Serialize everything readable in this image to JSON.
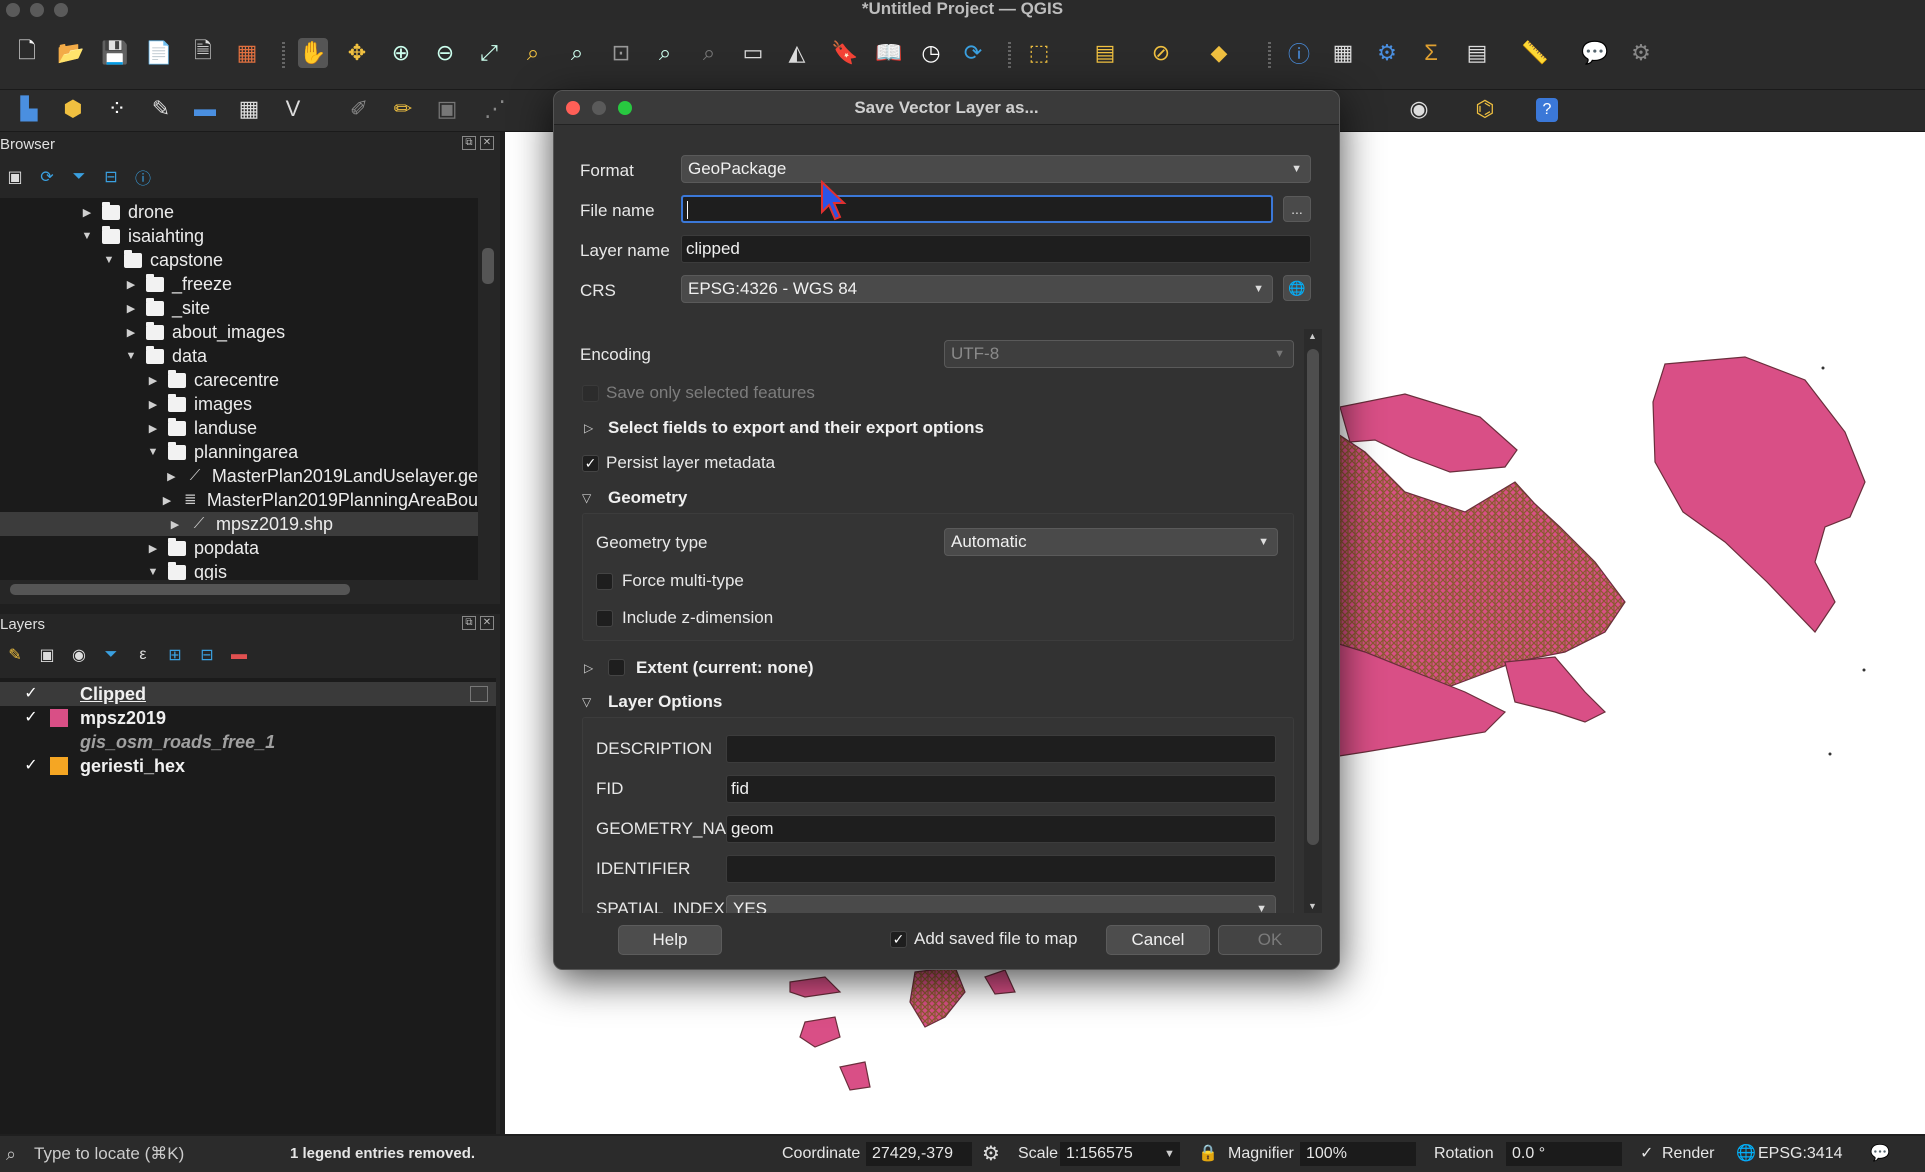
{
  "window": {
    "title": "*Untitled Project — QGIS"
  },
  "toolbar1": {
    "icons": [
      "new-project-icon",
      "open-project-icon",
      "save-project-icon",
      "new-print-layout-icon",
      "layout-manager-icon",
      "style-manager-icon",
      "pan-icon",
      "pan-to-selection-icon",
      "zoom-in-icon",
      "zoom-out-icon",
      "zoom-full-icon",
      "zoom-to-selection-icon",
      "zoom-to-layer-icon",
      "zoom-native-icon",
      "zoom-last-icon",
      "zoom-next-icon",
      "new-map-view-icon",
      "new-3d-view-icon",
      "new-bookmark-icon",
      "show-bookmarks-icon",
      "temporal-controller-icon",
      "refresh-icon",
      "select-features-icon",
      "select-by-value-icon",
      "deselect-icon",
      "select-location-icon",
      "identify-icon",
      "attribute-table-icon",
      "processing-toolbox-icon",
      "statistics-icon",
      "open-table-icon",
      "measure-icon",
      "map-tips-icon",
      "settings-gear-icon"
    ]
  },
  "toolbar2": {
    "icons": [
      "data-source-manager-icon",
      "new-geopackage-icon",
      "new-shapefile-icon",
      "digitize-icon",
      "add-layer-icon",
      "virtual-layer-icon",
      "new-vector-icon",
      "edit-pencil-icon",
      "toggle-editing-icon",
      "save-edits-icon",
      "vertex-tool-icon",
      "metasearch-icon",
      "python-icon",
      "help-icon"
    ]
  },
  "browser": {
    "title": "Browser",
    "tree": [
      {
        "label": "drone",
        "depth": 4,
        "caret": "right",
        "kind": "folder"
      },
      {
        "label": "isaiahting",
        "depth": 4,
        "caret": "down",
        "kind": "folder"
      },
      {
        "label": "capstone",
        "depth": 5,
        "caret": "down",
        "kind": "folder"
      },
      {
        "label": "_freeze",
        "depth": 6,
        "caret": "right",
        "kind": "folder"
      },
      {
        "label": "_site",
        "depth": 6,
        "caret": "right",
        "kind": "folder"
      },
      {
        "label": "about_images",
        "depth": 6,
        "caret": "right",
        "kind": "folder"
      },
      {
        "label": "data",
        "depth": 6,
        "caret": "down",
        "kind": "folder"
      },
      {
        "label": "carecentre",
        "depth": 7,
        "caret": "right",
        "kind": "folder"
      },
      {
        "label": "images",
        "depth": 7,
        "caret": "right",
        "kind": "folder"
      },
      {
        "label": "landuse",
        "depth": 7,
        "caret": "right",
        "kind": "folder"
      },
      {
        "label": "planningarea",
        "depth": 7,
        "caret": "down",
        "kind": "folder"
      },
      {
        "label": "MasterPlan2019LandUselayer.ge",
        "depth": 8,
        "caret": "right",
        "kind": "vector"
      },
      {
        "label": "MasterPlan2019PlanningAreaBou",
        "depth": 8,
        "caret": "right",
        "kind": "db"
      },
      {
        "label": "mpsz2019.shp",
        "depth": 8,
        "caret": "right",
        "kind": "vector",
        "selected": true
      },
      {
        "label": "popdata",
        "depth": 7,
        "caret": "right",
        "kind": "folder"
      },
      {
        "label": "qgis",
        "depth": 7,
        "caret": "down",
        "kind": "folder"
      }
    ]
  },
  "layers": {
    "title": "Layers",
    "items": [
      {
        "name": "Clipped",
        "checked": true,
        "color": "",
        "style": "underline",
        "selected": true
      },
      {
        "name": "mpsz2019",
        "checked": true,
        "color": "#d94f86"
      },
      {
        "name": "gis_osm_roads_free_1",
        "checked": false,
        "color": "",
        "style": "italic"
      },
      {
        "name": "geriesti_hex",
        "checked": true,
        "color": "#f5a623"
      }
    ]
  },
  "dialog": {
    "title": "Save Vector Layer as...",
    "format_label": "Format",
    "format_value": "GeoPackage",
    "filename_label": "File name",
    "filename_value": "",
    "browse_label": "...",
    "layername_label": "Layer name",
    "layername_value": "clipped",
    "crs_label": "CRS",
    "crs_value": "EPSG:4326 - WGS 84",
    "encoding_label": "Encoding",
    "encoding_value": "UTF-8",
    "save_selected_label": "Save only selected features",
    "select_fields_label": "Select fields to export and their export options",
    "persist_metadata_label": "Persist layer metadata",
    "persist_metadata_checked": true,
    "geometry_section": "Geometry",
    "geometry_type_label": "Geometry type",
    "geometry_type_value": "Automatic",
    "force_multi_label": "Force multi-type",
    "include_z_label": "Include z-dimension",
    "extent_label": "Extent (current: none)",
    "layer_options_section": "Layer Options",
    "options": [
      {
        "key": "DESCRIPTION",
        "value": ""
      },
      {
        "key": "FID",
        "value": "fid"
      },
      {
        "key": "GEOMETRY_NAME",
        "value": "geom"
      },
      {
        "key": "IDENTIFIER",
        "value": ""
      },
      {
        "key": "SPATIAL_INDEX",
        "value": "YES"
      }
    ],
    "help_label": "Help",
    "add_to_map_label": "Add saved file to map",
    "add_to_map_checked": true,
    "cancel_label": "Cancel",
    "ok_label": "OK"
  },
  "statusbar": {
    "locate_placeholder": "Type to locate (⌘K)",
    "message": "1 legend entries removed.",
    "coordinate_label": "Coordinate",
    "coordinate_value": "27429,-379",
    "scale_label": "Scale",
    "scale_value": "1:156575",
    "magnifier_label": "Magnifier",
    "magnifier_value": "100%",
    "rotation_label": "Rotation",
    "rotation_value": "0.0 °",
    "render_label": "Render",
    "render_checked": true,
    "crs_value": "EPSG:3414"
  },
  "colors": {
    "polygon_fill": "#d94f86",
    "clipped_fill": "#a05a3c",
    "accent": "#3b78d8"
  }
}
